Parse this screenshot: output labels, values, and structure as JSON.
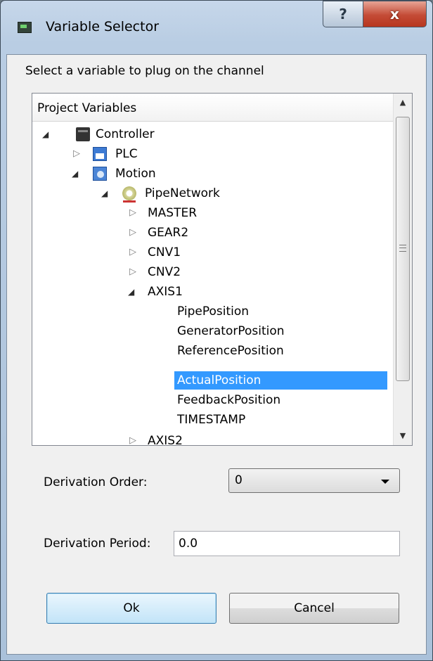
{
  "window": {
    "title": "Variable Selector",
    "help_glyph": "?",
    "close_glyph": "x"
  },
  "prompt": "Select a variable to plug on the channel",
  "tree": {
    "header": "Project Variables",
    "nodes": [
      {
        "label": "Controller",
        "expand": "open"
      },
      {
        "label": "PLC",
        "expand": "closed"
      },
      {
        "label": "Motion",
        "expand": "open"
      },
      {
        "label": "PipeNetwork",
        "expand": "open"
      },
      {
        "label": "MASTER",
        "expand": "closed"
      },
      {
        "label": "GEAR2",
        "expand": "closed"
      },
      {
        "label": "CNV1",
        "expand": "closed"
      },
      {
        "label": "CNV2",
        "expand": "closed"
      },
      {
        "label": "AXIS1",
        "expand": "open"
      },
      {
        "label": "PipePosition"
      },
      {
        "label": "GeneratorPosition"
      },
      {
        "label": "ReferencePosition"
      },
      {
        "label": "ActualPosition",
        "selected": true
      },
      {
        "label": "FeedbackPosition"
      },
      {
        "label": "TIMESTAMP"
      },
      {
        "label": "AXIS2",
        "expand": "closed"
      }
    ],
    "scrollbar": {
      "up": "▲",
      "down": "▼"
    }
  },
  "derivation_order": {
    "label": "Derivation Order:",
    "value": "0"
  },
  "derivation_period": {
    "label": "Derivation Period:",
    "value": "0.0"
  },
  "buttons": {
    "ok": "Ok",
    "cancel": "Cancel"
  },
  "colors": {
    "selection": "#3399ff",
    "close_button": "#c44b36"
  },
  "icons": {
    "expanded": "◢",
    "collapsed": "▷"
  }
}
